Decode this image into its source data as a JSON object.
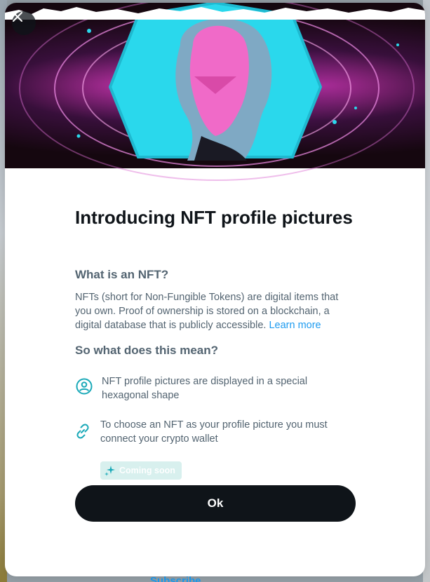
{
  "background": {
    "footer_text": "Subscribe"
  },
  "modal": {
    "close_icon": "close-icon",
    "title": "Introducing NFT profile pictures",
    "section1": {
      "heading": "What is an NFT?",
      "body": "NFTs (short for Non-Fungible Tokens) are digital items that you own. Proof of ownership is stored on a blockchain, a digital database that is publicly accessible. ",
      "link": "Learn more"
    },
    "section2": {
      "heading": "So what does this mean?"
    },
    "features": [
      {
        "icon": "profile-hexagon-icon",
        "text": "NFT profile pictures are displayed in a special hexagonal shape"
      },
      {
        "icon": "link-icon",
        "text": "To choose an NFT as your profile picture you must connect your crypto wallet",
        "badge": "Coming soon",
        "badge_icon": "sparkle-icon"
      }
    ],
    "ok_label": "Ok",
    "colors": {
      "accent": "#1d9bf0",
      "teal_icon": "#1aa9b8",
      "button": "#0f1419",
      "text_primary": "#0f1419",
      "text_secondary": "#536471"
    }
  }
}
